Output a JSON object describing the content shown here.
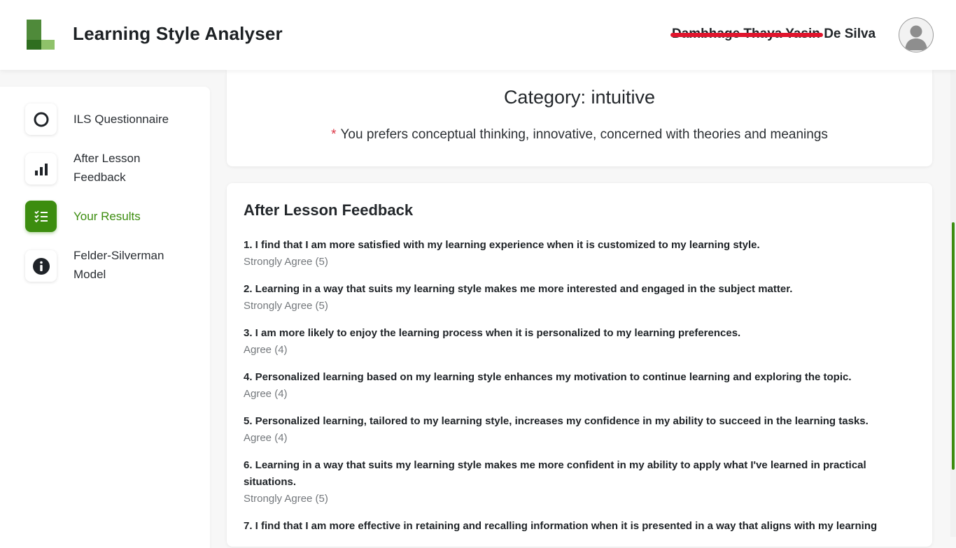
{
  "header": {
    "title": "Learning Style Analyser",
    "user_name_redacted": "Dambhage Thaya Yasin",
    "user_name_visible": "De Silva"
  },
  "sidebar": {
    "items": [
      {
        "label": "ILS Questionnaire",
        "icon": "circle-outline-icon",
        "active": false
      },
      {
        "label": "After Lesson Feedback",
        "icon": "bar-chart-icon",
        "active": false
      },
      {
        "label": "Your Results",
        "icon": "checklist-icon",
        "active": true
      },
      {
        "label": "Felder-Silverman Model",
        "icon": "info-icon",
        "active": false
      }
    ]
  },
  "category": {
    "title": "Category: intuitive",
    "marker": "*",
    "description": "You prefers conceptual thinking, innovative, concerned with theories and meanings"
  },
  "feedback": {
    "title": "After Lesson Feedback",
    "questions": [
      {
        "text": "1. I find that I am more satisfied with my learning experience when it is customized to my learning style.",
        "answer": "Strongly Agree (5)"
      },
      {
        "text": "2. Learning in a way that suits my learning style makes me more interested and engaged in the subject matter.",
        "answer": "Strongly Agree (5)"
      },
      {
        "text": "3. I am more likely to enjoy the learning process when it is personalized to my learning preferences.",
        "answer": "Agree (4)"
      },
      {
        "text": "4. Personalized learning based on my learning style enhances my motivation to continue learning and exploring the topic.",
        "answer": "Agree (4)"
      },
      {
        "text": "5. Personalized learning, tailored to my learning style, increases my confidence in my ability to succeed in the learning tasks.",
        "answer": "Agree (4)"
      },
      {
        "text": "6. Learning in a way that suits my learning style makes me more confident in my ability to apply what I've learned in practical situations.",
        "answer": "Strongly Agree (5)"
      },
      {
        "text": "7. I find that I am more effective in retaining and recalling information when it is presented in a way that aligns with my learning",
        "answer": ""
      }
    ]
  },
  "colors": {
    "accent": "#3c8d0f",
    "redaction": "#e0152d"
  }
}
